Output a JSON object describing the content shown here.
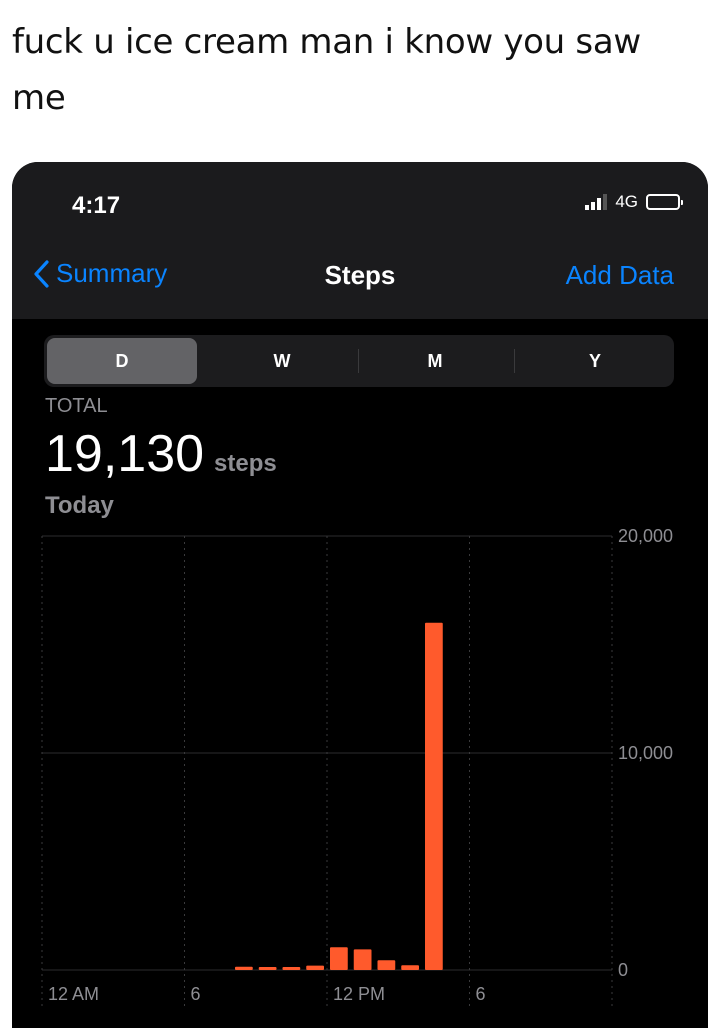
{
  "caption": "fuck u ice cream man i know you saw me",
  "status_bar": {
    "time": "4:17",
    "network": "4G"
  },
  "nav": {
    "back_label": "Summary",
    "title": "Steps",
    "action_label": "Add Data"
  },
  "segments": [
    "D",
    "W",
    "M",
    "Y"
  ],
  "selected_segment": "D",
  "summary": {
    "label": "TOTAL",
    "value": "19,130",
    "unit": "steps",
    "period": "Today"
  },
  "colors": {
    "accent": "#0a84ff",
    "bar": "#ff5a2c",
    "background": "#000000"
  },
  "chart_data": {
    "type": "bar",
    "x_tick_labels": [
      "12 AM",
      "6",
      "12 PM",
      "6"
    ],
    "y_tick_labels": [
      "20,000",
      "10,000",
      "0"
    ],
    "ylim": [
      0,
      20000
    ],
    "grid": true,
    "categories": [
      0,
      1,
      2,
      3,
      4,
      5,
      6,
      7,
      8,
      9,
      10,
      11,
      12,
      13,
      14,
      15,
      16,
      17,
      18,
      19,
      20,
      21,
      22,
      23
    ],
    "values": [
      0,
      0,
      0,
      0,
      0,
      0,
      0,
      0,
      150,
      120,
      120,
      200,
      1050,
      950,
      450,
      220,
      16000,
      0,
      0,
      0,
      0,
      0,
      0,
      0
    ]
  }
}
